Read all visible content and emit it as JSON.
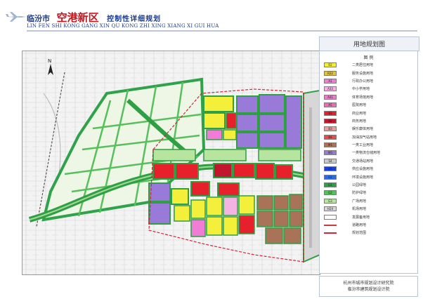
{
  "header": {
    "city": "临汾市",
    "zone": "空港新区",
    "plan": "控制性详细规划",
    "subtitle": "LIN FEN SHI KONG GANG XIN QU KONG ZHI XING XIANG XI GUI HUA"
  },
  "sheet": {
    "title": "用地规划图"
  },
  "legend": {
    "title": "图 例",
    "items": [
      {
        "code": "R2",
        "label": "二类居住用地",
        "color": "#f3ef3b"
      },
      {
        "code": "R22",
        "label": "服务设施用地",
        "color": "#e3c23d"
      },
      {
        "code": "A1",
        "label": "行政办公用地",
        "color": "#f07cd6"
      },
      {
        "code": "A33",
        "label": "中小学用地",
        "color": "#f5b3e3"
      },
      {
        "code": "A41",
        "label": "体育场馆用地",
        "color": "#e57fc9"
      },
      {
        "code": "A5",
        "label": "医院用地",
        "color": "#ec6cb7"
      },
      {
        "code": "B1",
        "label": "商业用地",
        "color": "#e6212c"
      },
      {
        "code": "B2",
        "label": "商务用地",
        "color": "#c0172e"
      },
      {
        "code": "B3",
        "label": "娱乐康体用地",
        "color": "#f19a9f"
      },
      {
        "code": "B4",
        "label": "加油加气站用地",
        "color": "#e94b4b"
      },
      {
        "code": "M1",
        "label": "一类工业用地",
        "color": "#a9735a"
      },
      {
        "code": "W1",
        "label": "一类物流仓储用地",
        "color": "#9a7ad9"
      },
      {
        "code": "S4",
        "label": "交通场站用地",
        "color": "#c9c9c9"
      },
      {
        "code": "U1",
        "label": "供应设施用地",
        "color": "#1c3fd4"
      },
      {
        "code": "U2",
        "label": "环境设施用地",
        "color": "#2d6be0"
      },
      {
        "code": "G1",
        "label": "公园绿地",
        "color": "#27a345"
      },
      {
        "code": "G2",
        "label": "防护绿地",
        "color": "#53c05b"
      },
      {
        "code": "G3",
        "label": "广场用地",
        "color": "#b7e59f"
      },
      {
        "code": "H24",
        "label": "机场用地",
        "color": "#d7d7d7"
      },
      {
        "code": "",
        "label": "发展备用地",
        "color": "#ffffff"
      },
      {
        "code": "",
        "label": "道路用地",
        "color": "#c93c3c"
      },
      {
        "code": "",
        "label": "规划范围",
        "color": "#d2263a"
      }
    ]
  },
  "institute": {
    "line1": "杭州市城市规划设计研究院",
    "line2": "临汾市建筑规划设计院"
  }
}
